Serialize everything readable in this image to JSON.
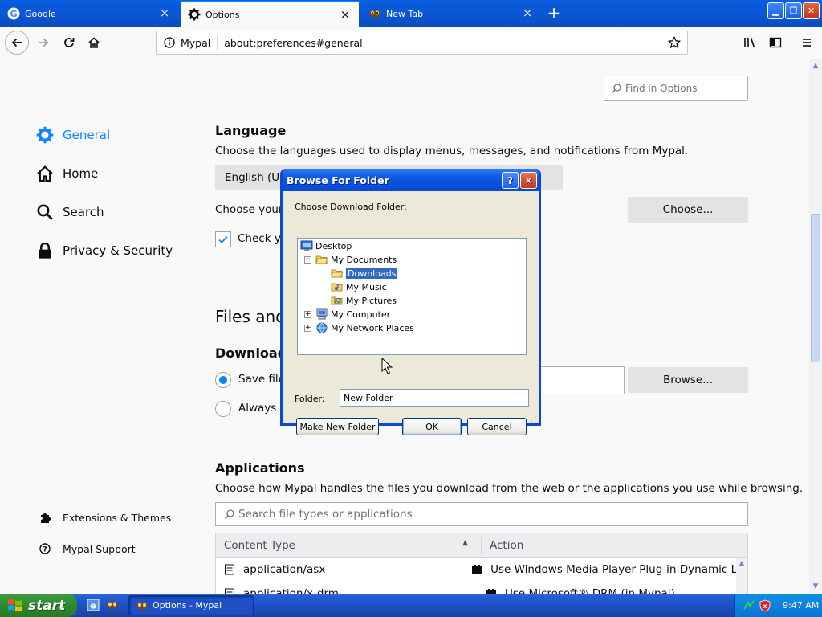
{
  "tabs": [
    {
      "title": "Google",
      "icon": "google-icon",
      "active": false
    },
    {
      "title": "Options",
      "icon": "gear-icon",
      "active": true
    },
    {
      "title": "New Tab",
      "icon": "mypal-icon",
      "active": false
    }
  ],
  "navbar": {
    "identity": "Mypal",
    "url": "about:preferences#general"
  },
  "find_in_options": {
    "placeholder": "Find in Options"
  },
  "sidebar": {
    "items": [
      {
        "label": "General",
        "icon": "gear-icon",
        "selected": true
      },
      {
        "label": "Home",
        "icon": "home-icon",
        "selected": false
      },
      {
        "label": "Search",
        "icon": "search-icon",
        "selected": false
      },
      {
        "label": "Privacy & Security",
        "icon": "lock-icon",
        "selected": false
      }
    ],
    "footer": [
      {
        "label": "Extensions & Themes",
        "icon": "puzzle-icon"
      },
      {
        "label": "Mypal Support",
        "icon": "help-icon"
      }
    ]
  },
  "language": {
    "heading": "Language",
    "description": "Choose the languages used to display menus, messages, and notifications from Mypal.",
    "selected_language": "English (Un",
    "choose_text": "Choose your",
    "choose_button": "Choose...",
    "check_label": "Check yo"
  },
  "files": {
    "heading": "Files and",
    "downloads_heading": "Download",
    "save_files_label": "Save files",
    "always_ask_label": "Always a",
    "browse_button": "Browse..."
  },
  "applications": {
    "heading": "Applications",
    "description": "Choose how Mypal handles the files you download from the web or the applications you use while browsing.",
    "search_placeholder": "Search file types or applications",
    "columns": [
      "Content Type",
      "Action"
    ],
    "rows": [
      {
        "type": "application/asx",
        "action": "Use Windows Media Player Plug-in Dynamic L..."
      },
      {
        "type": "application/x-drm",
        "action": "Use Microsoft® DRM (in Mypal)"
      }
    ]
  },
  "dialog": {
    "title": "Browse For Folder",
    "prompt": "Choose Download Folder:",
    "tree": [
      {
        "label": "Desktop",
        "icon": "desktop-icon",
        "level": 0,
        "expander": "",
        "selected": false
      },
      {
        "label": "My Documents",
        "icon": "folder-open-icon",
        "level": 1,
        "expander": "−",
        "selected": false
      },
      {
        "label": "Downloads",
        "icon": "folder-icon",
        "level": 2,
        "expander": "",
        "selected": true
      },
      {
        "label": "My Music",
        "icon": "music-folder-icon",
        "level": 2,
        "expander": "",
        "selected": false
      },
      {
        "label": "My Pictures",
        "icon": "pictures-folder-icon",
        "level": 2,
        "expander": "",
        "selected": false
      },
      {
        "label": "My Computer",
        "icon": "computer-icon",
        "level": 1,
        "expander": "+",
        "selected": false
      },
      {
        "label": "My Network Places",
        "icon": "network-icon",
        "level": 1,
        "expander": "+",
        "selected": false
      }
    ],
    "folder_label": "Folder:",
    "folder_value": "New Folder",
    "make_new_folder": "Make New Folder",
    "ok": "OK",
    "cancel": "Cancel"
  },
  "taskbar": {
    "start": "start",
    "task_item": "Options - Mypal",
    "clock": "9:47 AM"
  },
  "colors": {
    "accent": "#0a84ff",
    "xp_blue": "#0a48d8",
    "xp_green": "#3c9a3c"
  }
}
